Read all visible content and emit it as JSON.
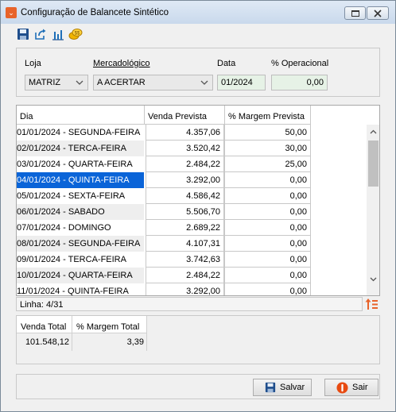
{
  "window": {
    "title": "Configuração de Balancete Sintético"
  },
  "toolbar": {
    "icons": [
      "save-icon",
      "export-icon",
      "chart-icon",
      "coins-icon"
    ]
  },
  "filters": {
    "loja_label": "Loja",
    "loja_value": "MATRIZ",
    "mercadologico_label": "Mercadológico",
    "mercadologico_value": "A ACERTAR",
    "data_label": "Data",
    "data_value": "01/2024",
    "operacional_label": "% Operacional",
    "operacional_value": "0,00"
  },
  "grid": {
    "columns": [
      "Dia",
      "Venda Prevista",
      "% Margem Prevista"
    ],
    "rows": [
      {
        "dia": "01/01/2024 - SEGUNDA-FEIRA",
        "venda": "4.357,06",
        "margem": "50,00"
      },
      {
        "dia": "02/01/2024 - TERCA-FEIRA",
        "venda": "3.520,42",
        "margem": "30,00"
      },
      {
        "dia": "03/01/2024 - QUARTA-FEIRA",
        "venda": "2.484,22",
        "margem": "25,00"
      },
      {
        "dia": "04/01/2024 - QUINTA-FEIRA",
        "venda": "3.292,00",
        "margem": "0,00"
      },
      {
        "dia": "05/01/2024 - SEXTA-FEIRA",
        "venda": "4.586,42",
        "margem": "0,00"
      },
      {
        "dia": "06/01/2024 - SABADO",
        "venda": "5.506,70",
        "margem": "0,00"
      },
      {
        "dia": "07/01/2024 - DOMINGO",
        "venda": "2.689,22",
        "margem": "0,00"
      },
      {
        "dia": "08/01/2024 - SEGUNDA-FEIRA",
        "venda": "4.107,31",
        "margem": "0,00"
      },
      {
        "dia": "09/01/2024 - TERCA-FEIRA",
        "venda": "3.742,63",
        "margem": "0,00"
      },
      {
        "dia": "10/01/2024 - QUARTA-FEIRA",
        "venda": "2.484,22",
        "margem": "0,00"
      },
      {
        "dia": "11/01/2024 - QUINTA-FEIRA",
        "venda": "3.292,00",
        "margem": "0,00"
      }
    ],
    "selected_index": 3
  },
  "status": {
    "line_text": "Linha: 4/31"
  },
  "totals": {
    "venda_label": "Venda Total",
    "venda_value": "101.548,12",
    "margem_label": "% Margem Total",
    "margem_value": "3,39"
  },
  "footer": {
    "salvar_label": "Salvar",
    "sair_label": "Sair"
  },
  "colors": {
    "selection": "#0a64d8",
    "sair_icon": "#e84a10",
    "sort_icon": "#e8632a"
  }
}
